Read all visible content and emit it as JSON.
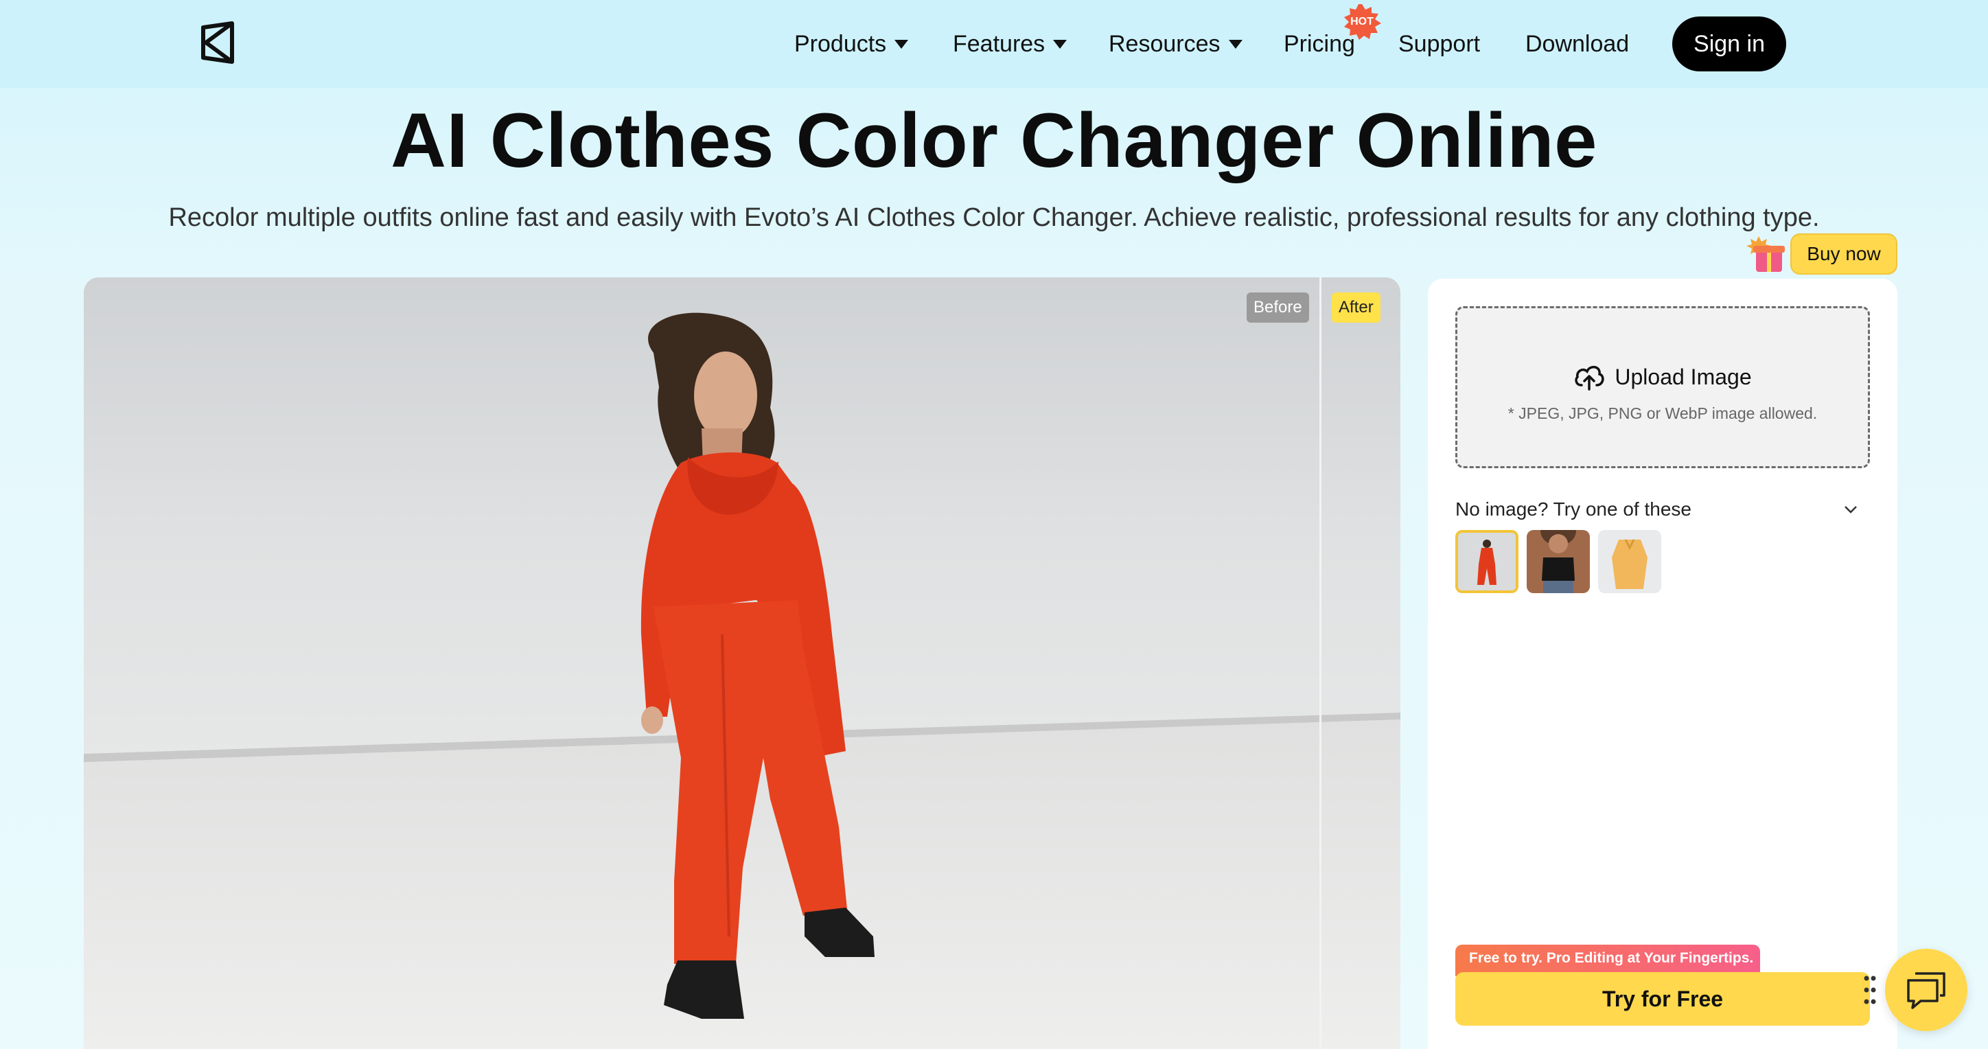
{
  "nav": {
    "items": [
      {
        "label": "Products",
        "dropdown": true
      },
      {
        "label": "Features",
        "dropdown": true
      },
      {
        "label": "Resources",
        "dropdown": true
      },
      {
        "label": "Pricing",
        "dropdown": false
      },
      {
        "label": "Support",
        "dropdown": false
      },
      {
        "label": "Download",
        "dropdown": false
      }
    ],
    "hot_badge": "HOT",
    "signin_label": "Sign in",
    "icons": {
      "logo": "evoto-logo-icon",
      "caret": "caret-down-icon"
    }
  },
  "hero": {
    "title": "AI Clothes Color Changer Online",
    "subtitle": "Recolor multiple outfits online fast and easily with Evoto’s AI Clothes Color Changer. Achieve realistic, professional results for any clothing type."
  },
  "preview": {
    "before_label": "Before",
    "after_label": "After"
  },
  "panel": {
    "buy_now_label": "Buy now",
    "upload_label": "Upload Image",
    "upload_hint": "* JPEG, JPG, PNG or WebP image allowed.",
    "samples_heading": "No image? Try one of these",
    "samples": [
      "red-outfit-sample",
      "black-top-sample",
      "yellow-shirt-sample"
    ],
    "promo_ribbon": "Free to try. Pro Editing at Your Fingertips.",
    "try_free_label": "Try for Free"
  },
  "colors": {
    "accent_yellow": "#ffd84d",
    "hot_badge": "#f25a3c",
    "outfit_red": "#e8381a",
    "signin_bg": "#000000"
  }
}
